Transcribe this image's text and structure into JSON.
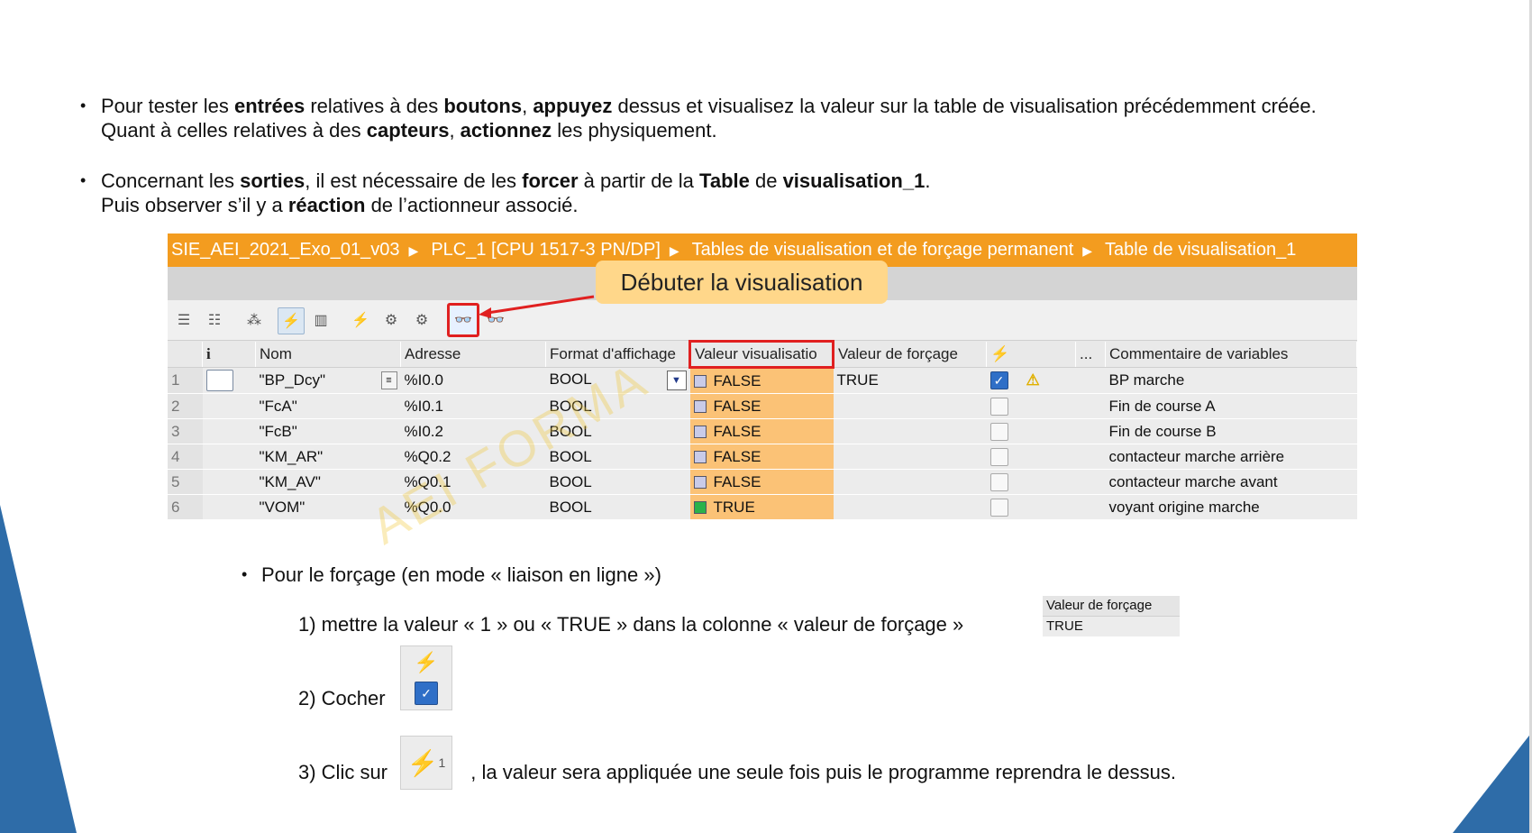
{
  "bullets": {
    "b1": {
      "t1": "Pour tester les ",
      "b1": "entrées",
      "t2": " relatives à des ",
      "b2": "boutons",
      "t3": ", ",
      "b3": "appuyez",
      "t4": " dessus et visualisez la valeur sur la table de visualisation précédemment créée.",
      "l2a": "Quant à celles relatives à des ",
      "l2b": "capteurs",
      "l2c": ", ",
      "l2d": "actionnez",
      "l2e": " les physiquement."
    },
    "b2": {
      "t1": "Concernant les ",
      "b1": "sorties",
      "t2": ", il est nécessaire de les ",
      "b2": "forcer",
      "t3": " à partir de la ",
      "b3": "Table",
      "t4": " de ",
      "b4": "visualisation_1",
      "t5": ".",
      "l2a": "Puis observer s’il y a ",
      "l2b": "réaction",
      "l2c": " de l’actionneur associé."
    }
  },
  "breadcrumb": [
    "SIE_AEI_2021_Exo_01_v03",
    "PLC_1 [CPU 1517-3 PN/DP]",
    "Tables de visualisation et de forçage permanent",
    "Table de visualisation_1"
  ],
  "callout": "Débuter la visualisation",
  "table": {
    "headers": [
      "",
      "i",
      "Nom",
      "Adresse",
      "Format d'affichage",
      "Valeur visualisatio",
      "Valeur de forçage",
      "⚡",
      "...",
      "Commentaire de variables"
    ],
    "rows": [
      {
        "num": "1",
        "name": "\"BP_Dcy\"",
        "addr": "%I0.0",
        "fmt": "BOOL",
        "val": "FALSE",
        "force": "TRUE",
        "checked": true,
        "comment": "BP marche"
      },
      {
        "num": "2",
        "name": "\"FcA\"",
        "addr": "%I0.1",
        "fmt": "BOOL",
        "val": "FALSE",
        "force": "",
        "checked": false,
        "comment": "Fin de course A"
      },
      {
        "num": "3",
        "name": "\"FcB\"",
        "addr": "%I0.2",
        "fmt": "BOOL",
        "val": "FALSE",
        "force": "",
        "checked": false,
        "comment": "Fin de course B"
      },
      {
        "num": "4",
        "name": "\"KM_AR\"",
        "addr": "%Q0.2",
        "fmt": "BOOL",
        "val": "FALSE",
        "force": "",
        "checked": false,
        "comment": "contacteur marche arrière"
      },
      {
        "num": "5",
        "name": "\"KM_AV\"",
        "addr": "%Q0.1",
        "fmt": "BOOL",
        "val": "FALSE",
        "force": "",
        "checked": false,
        "comment": "contacteur marche avant"
      },
      {
        "num": "6",
        "name": "\"VOM\"",
        "addr": "%Q0.0",
        "fmt": "BOOL",
        "val": "TRUE",
        "force": "",
        "checked": false,
        "comment": "voyant origine marche"
      }
    ]
  },
  "watermark": "AEI FORMA",
  "forcing": {
    "title": "Pour le forçage (en mode « liaison en ligne »)",
    "step1": "1)  mettre la valeur « 1  » ou « TRUE » dans la colonne « valeur de forçage »",
    "step2": "2)  Cocher",
    "step3a": "3) Clic sur",
    "step3b": ", la valeur sera appliquée une seule fois puis le programme reprendra le dessus.",
    "mini_header": "Valeur de forçage",
    "mini_value": "TRUE"
  }
}
